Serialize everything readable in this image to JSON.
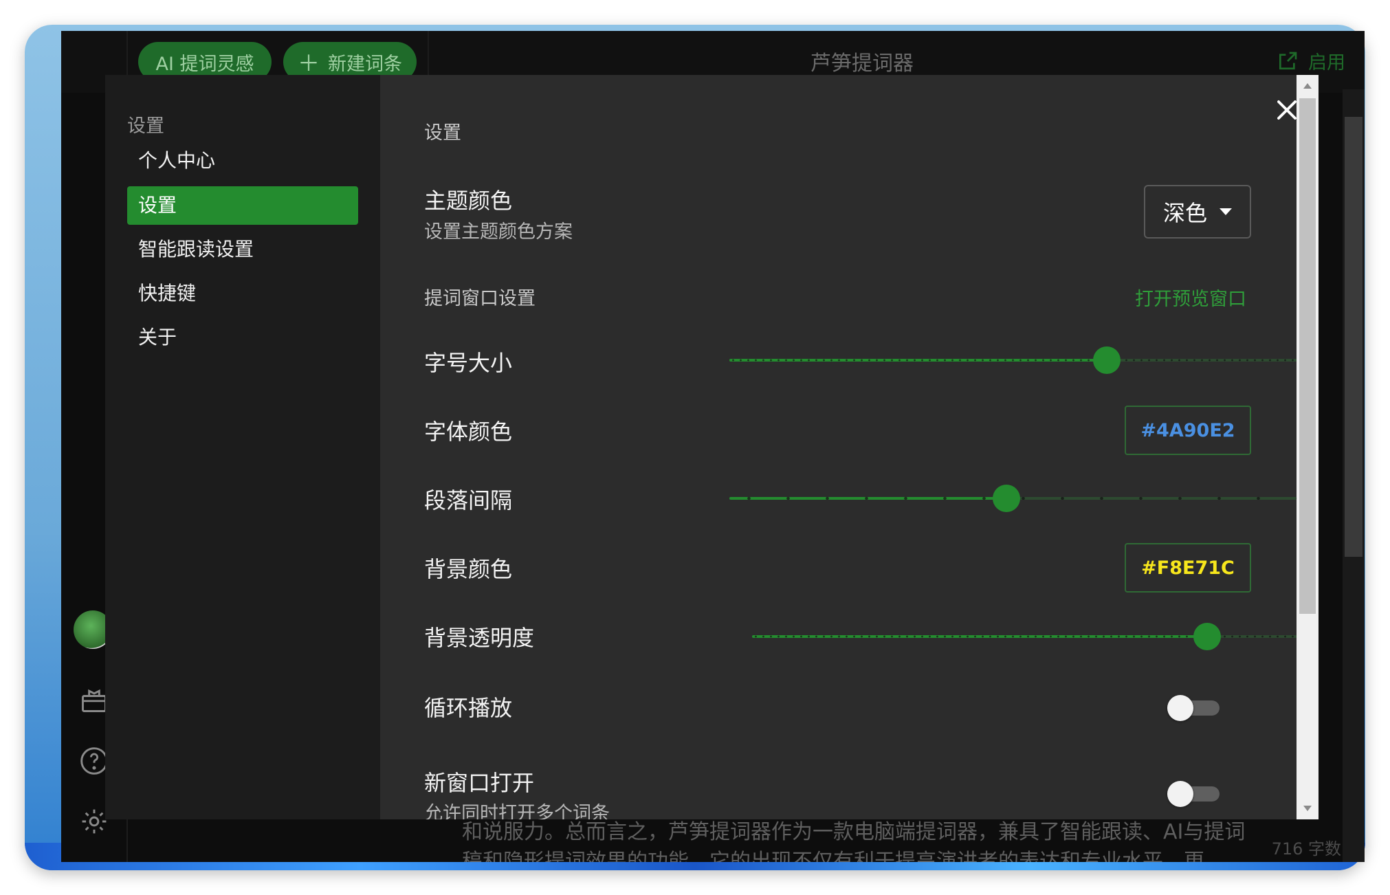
{
  "app": {
    "title": "芦笋提词器",
    "ai_button": "AI 提词灵感",
    "new_button": "新建词条",
    "launch_label": "启用",
    "background_text_line1": "和说服力。总而言之，芦笋提词器作为一款电脑端提词器，兼具了智能跟读、AI与提词",
    "background_text_line2": "稿和隐形提词效果的功能，它的出现不仅有利于提高演讲者的表达和专业水平，更",
    "word_count": "716 字数"
  },
  "nav": {
    "heading": "设置",
    "items": [
      {
        "label": "个人中心",
        "active": false
      },
      {
        "label": "设置",
        "active": true
      },
      {
        "label": "智能跟读设置",
        "active": false
      },
      {
        "label": "快捷键",
        "active": false
      },
      {
        "label": "关于",
        "active": false
      }
    ]
  },
  "settings": {
    "title": "设置",
    "theme": {
      "label": "主题颜色",
      "sub": "设置主题颜色方案",
      "value": "深色"
    },
    "window_section": "提词窗口设置",
    "preview_link": "打开预览窗口",
    "font_size": {
      "label": "字号大小",
      "level": 0.6
    },
    "font_color": {
      "label": "字体颜色",
      "value": "#4A90E2"
    },
    "paragraph_spacing": {
      "label": "段落间隔",
      "level": 0.44
    },
    "bg_color": {
      "label": "背景颜色",
      "value": "#F8E71C"
    },
    "bg_opacity": {
      "label": "背景透明度",
      "level": 0.75
    },
    "loop_play": {
      "label": "循环播放",
      "on": false
    },
    "new_window": {
      "label": "新窗口打开",
      "sub": "允许同时打开多个词条",
      "on": false
    }
  },
  "colors": {
    "accent": "#248C2F",
    "panel": "#2C2C2C",
    "nav": "#1C1C1C"
  }
}
